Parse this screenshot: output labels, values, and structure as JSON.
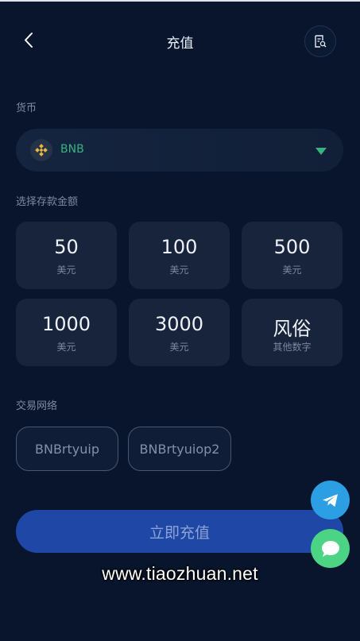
{
  "header": {
    "title": "充值",
    "back_icon": "chevron-left-icon",
    "record_icon": "document-search-icon"
  },
  "currency": {
    "label": "货币",
    "selected": "BNB",
    "coin_icon": "bnb-icon",
    "dropdown_icon": "caret-down-icon"
  },
  "amount": {
    "label": "选择存款金额",
    "options": [
      {
        "value": "50",
        "unit": "美元"
      },
      {
        "value": "100",
        "unit": "美元"
      },
      {
        "value": "500",
        "unit": "美元"
      },
      {
        "value": "1000",
        "unit": "美元"
      },
      {
        "value": "3000",
        "unit": "美元"
      },
      {
        "value": "风俗",
        "unit": "其他数字"
      }
    ]
  },
  "network": {
    "label": "交易网络",
    "options": [
      "BNBrtyuip",
      "BNBrtyuiop2"
    ]
  },
  "submit_label": "立即充值",
  "watermark": "www.tiaozhuan.net",
  "floating": {
    "telegram_icon": "telegram-icon",
    "chat_icon": "chat-bubble-icon"
  },
  "colors": {
    "background": "#08152c",
    "card": "#17243b",
    "accent_green": "#36b37e",
    "submit": "#1f48a6",
    "telegram": "#2b9ee4",
    "chat": "#4cd383"
  }
}
